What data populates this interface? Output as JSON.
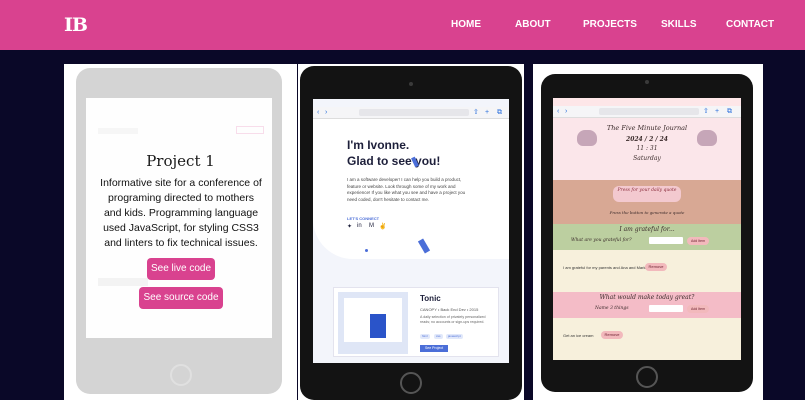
{
  "header": {
    "logo": "IB",
    "nav": [
      "HOME",
      "ABOUT",
      "PROJECTS",
      "SKILLS",
      "CONTACT"
    ],
    "bg_color": "#d9428f"
  },
  "project1": {
    "title": "Project 1",
    "description": "Informative site for a conference of programing directed to mothers and kids. Programming language used JavaScript, for styling CSS3 and linters to fix technical issues.",
    "live_label": "See live code",
    "source_label": "See source code"
  },
  "project2": {
    "greeting_line1": "I'm Ivonne.",
    "greeting_line2": "Glad to see you!",
    "intro": "I am a software developer! I can help you build a product, feature or website. Look through some of my work and experience! If you like what you see and have a project you need coded, don't hesitate to contact me.",
    "connect": "LET'S CONNECT",
    "tonic_title": "Tonic",
    "tonic_meta": "CANOPY  •  Back End Dev  •  2015",
    "tonic_desc": "A daily selection of privately personalized reads; no accounts or sign-ups required.",
    "tags": [
      "html",
      "css",
      "javascript"
    ],
    "see_project": "See Project"
  },
  "project3": {
    "app_title": "The Five Minute Journal",
    "date": "2024 / 2 / 24",
    "time": "11 : 31",
    "weekday": "Saturday",
    "quote_button": "Press for your daily quote",
    "quote_hint": "Press the button to generate a quote",
    "grateful_heading": "I am grateful for...",
    "grateful_prompt": "What are you grateful for?",
    "grateful_item": "I am grateful for my parents and Ana and Mark",
    "better_heading": "What would make today great?",
    "better_prompt": "Name 3 things",
    "better_item": "Get an ice cream",
    "add_label": "Add Item",
    "remove_label": "Remove"
  }
}
